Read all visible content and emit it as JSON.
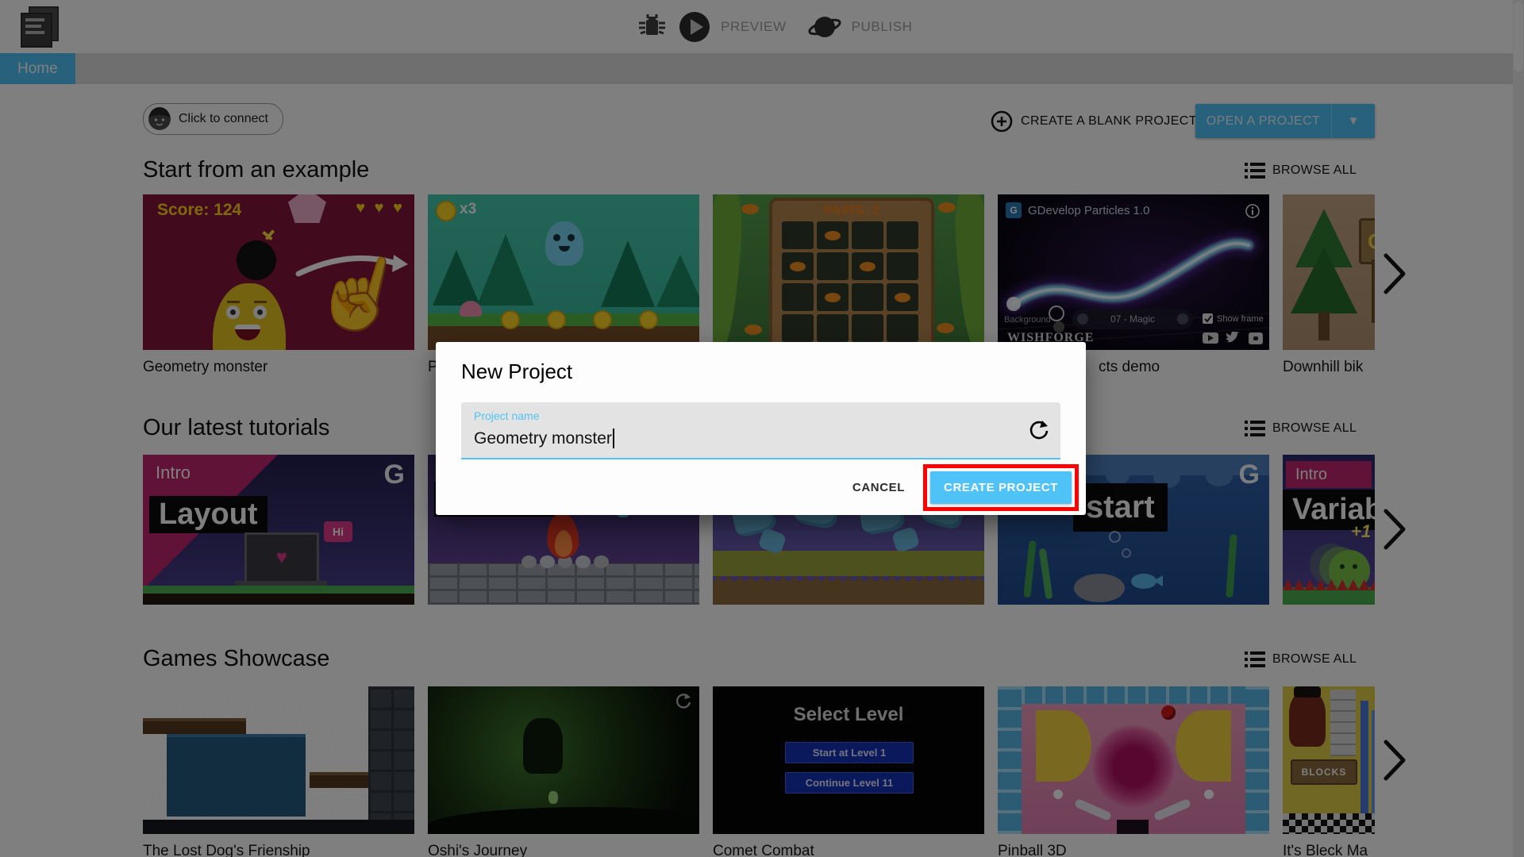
{
  "colors": {
    "accent": "#4FC3F7",
    "annotation_red": "#FF0000"
  },
  "toolbar": {
    "preview": "PREVIEW",
    "publish": "PUBLISH"
  },
  "tabs": {
    "home": "Home"
  },
  "header": {
    "connect": "Click to connect",
    "create_blank": "CREATE A BLANK PROJECT",
    "open_project": "OPEN A PROJECT"
  },
  "sections": {
    "examples": {
      "title": "Start from an example",
      "browse": "BROWSE ALL",
      "cards": {
        "geometry": {
          "caption": "Geometry monster",
          "score": "Score: 124",
          "hearts": "♥ ♥ ♥",
          "hand_icon": "☝"
        },
        "platformer": {
          "caption": "P",
          "counter": "x3"
        },
        "pairs": {
          "board_title": "PAIRS: 2"
        },
        "particles": {
          "caption": "cts demo",
          "title": "GDevelop Particles 1.0",
          "logo": "G",
          "background": "Background",
          "selector": "07 - Magic",
          "show_frame": "Show frame",
          "brand": "WISHFORGE"
        },
        "downhill": {
          "caption": "Downhill bik",
          "sign": "G"
        }
      }
    },
    "tutorials": {
      "title": "Our latest tutorials",
      "browse": "BROWSE ALL",
      "cards": {
        "layout": {
          "intro": "Intro",
          "word": "Layout",
          "hi": "Hi",
          "heart_icon": "♥",
          "logo": "G"
        },
        "quickstart": {
          "word": "start",
          "logo": "G"
        },
        "variables": {
          "intro": "Intro",
          "word": "Variab",
          "plus": "+1"
        }
      }
    },
    "showcase": {
      "title": "Games Showcase",
      "browse": "BROWSE ALL",
      "cards": {
        "lostdog": {
          "caption": "The Lost Dog's Frienship"
        },
        "oshi": {
          "caption": "Oshi's Journey"
        },
        "comet": {
          "caption": "Comet Combat",
          "title": "Select Level",
          "btn1": "Start at Level 1",
          "btn2": "Continue Level 11"
        },
        "pinball": {
          "caption": "Pinball 3D"
        },
        "bleck": {
          "caption": "It's Bleck Ma",
          "sign": "BLOCKS"
        }
      }
    }
  },
  "modal": {
    "title": "New Project",
    "field_label": "Project name",
    "field_value": "Geometry monster",
    "cancel": "CANCEL",
    "create": "CREATE PROJECT"
  }
}
